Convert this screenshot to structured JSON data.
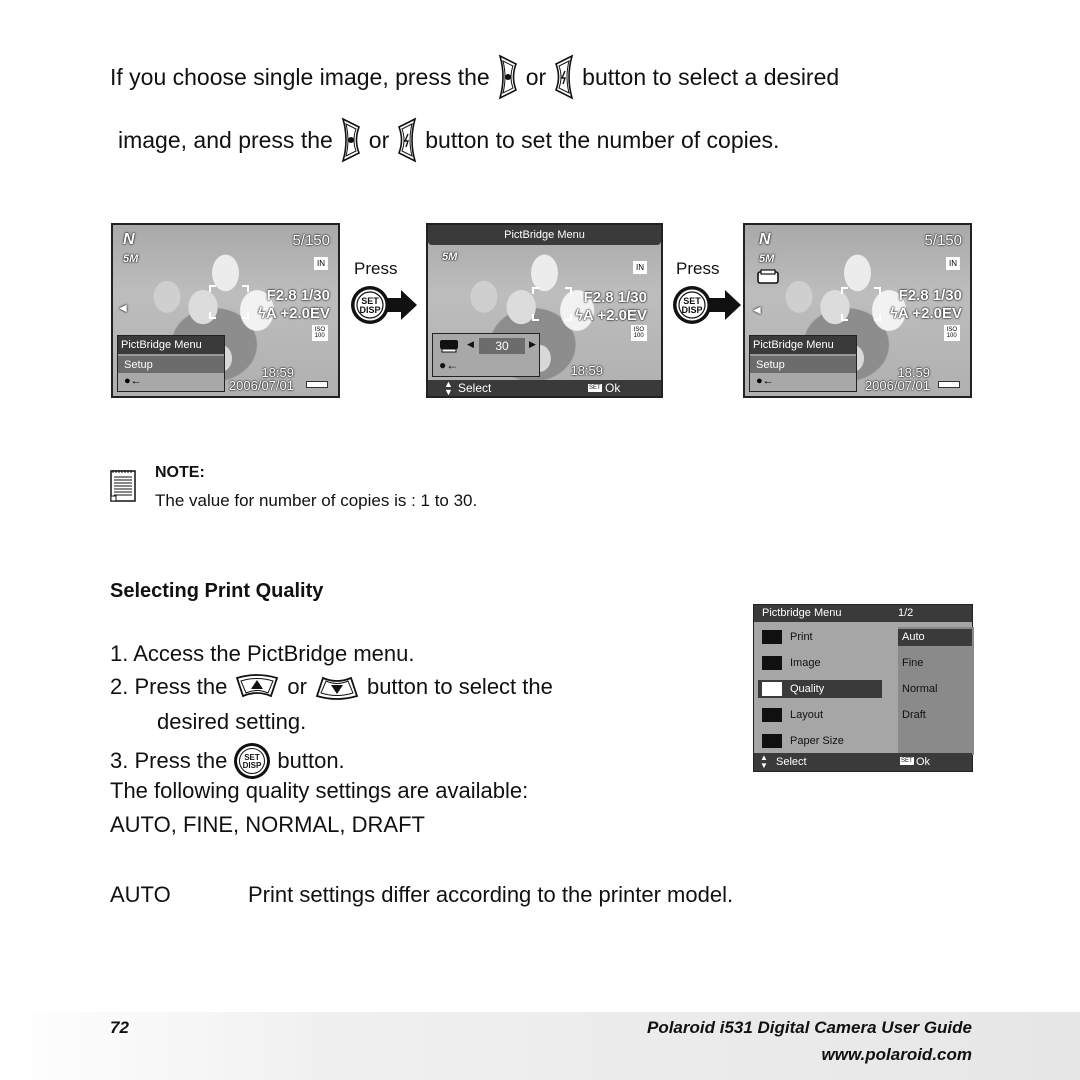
{
  "intro": {
    "line1_a": "If you choose single image, press the",
    "line1_or": "or",
    "line1_b": "button to select a desired",
    "line2_a": "image, and press  the",
    "line2_or": "or",
    "line2_b": "button to set the number of copies.",
    "icons": [
      "left-focus-button-icon",
      "right-flash-button-icon"
    ]
  },
  "screens": [
    {
      "counter": "5/150",
      "resolution": "5M",
      "memory": "IN",
      "aperture_shutter": "F2.8  1/30",
      "flash_ev": "ϟA  +2.0EV",
      "iso": "ISO 100",
      "time": "18:59",
      "date": "2006/07/01",
      "menu_title": "PictBridge Menu",
      "menu_selected": "Setup",
      "menu_back": "●←"
    },
    {
      "top_title": "PictBridge Menu",
      "resolution": "5M",
      "memory": "IN",
      "aperture_shutter": "F2.8  1/30",
      "flash_ev": "ϟA  +2.0EV",
      "iso": "ISO 100",
      "time": "18:59",
      "copies_value": "30",
      "menu_back": "●←",
      "footer_select": "Select",
      "footer_ok_key": "SET",
      "footer_ok": "Ok"
    },
    {
      "counter": "5/150",
      "resolution": "5M",
      "memory": "IN",
      "aperture_shutter": "F2.8  1/30",
      "flash_ev": "ϟA  +2.0EV",
      "iso": "ISO 100",
      "time": "18:59",
      "date": "2006/07/01",
      "menu_title": "PictBridge Menu",
      "menu_selected": "Setup",
      "menu_back": "●←"
    }
  ],
  "press_labels": [
    "Press",
    "Press"
  ],
  "set_button": {
    "line1": "SET",
    "line2": "DISP"
  },
  "note": {
    "title": "NOTE:",
    "text": "The  value for number of copies is : 1 to 30."
  },
  "section": {
    "heading": "Selecting Print Quality",
    "step1": "1.  Access the PictBridge menu.",
    "step2_a": "2.  Press the",
    "step2_or": "or",
    "step2_b": "button to select the",
    "step2_c": "desired setting.",
    "step3_a": "3.  Press the",
    "step3_b": "button.",
    "available": "The following quality settings are available:",
    "options_line": "AUTO, FINE, NORMAL, DRAFT"
  },
  "quality_menu": {
    "title": "Pictbridge Menu",
    "page": "1/2",
    "items": [
      "Print",
      "Image",
      "Quality",
      "Layout",
      "Paper Size"
    ],
    "selected_item": "Quality",
    "options": [
      "Auto",
      "Fine",
      "Normal",
      "Draft"
    ],
    "selected_option": "Auto",
    "footer_select": "Select",
    "footer_ok_key": "SET",
    "footer_ok": "Ok"
  },
  "definition": {
    "term": "AUTO",
    "desc": "Print settings differ according to the printer model."
  },
  "footer": {
    "page_number": "72",
    "guide_title": "Polaroid i531 Digital Camera User Guide",
    "url": "www.polaroid.com"
  }
}
